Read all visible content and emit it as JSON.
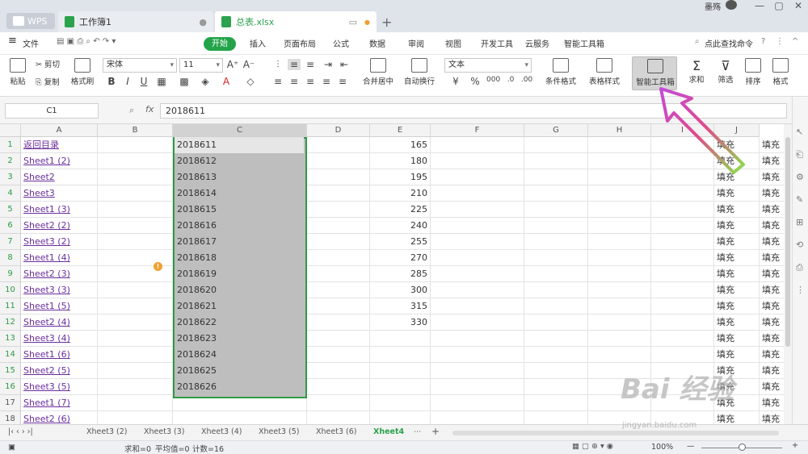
{
  "titlebar": {
    "wps": "WPS",
    "tab1": "工作簿1",
    "tab2": "总表.xlsx",
    "user": "墨殇"
  },
  "menu": {
    "file": "文件",
    "items": [
      "开始",
      "插入",
      "页面布局",
      "公式",
      "数据",
      "审阅",
      "视图",
      "开发工具",
      "云服务",
      "智能工具箱"
    ],
    "search": "点此查找命令"
  },
  "ribbon": {
    "paste": "粘贴",
    "cut": "剪切",
    "copy": "复制",
    "format_painter": "格式刷",
    "font": "宋体",
    "size": "11",
    "merge": "合并居中",
    "wrap": "自动换行",
    "numfmt": "文本",
    "cond": "条件格式",
    "table_style": "表格样式",
    "smart": "智能工具箱",
    "sum": "求和",
    "filter": "筛选",
    "sort": "排序",
    "format": "格式"
  },
  "formula": {
    "cell": "C1",
    "fx": "fx",
    "value": "2018611"
  },
  "columns": [
    "A",
    "B",
    "C",
    "D",
    "E",
    "F",
    "G",
    "H",
    "I",
    "J"
  ],
  "rows": [
    "1",
    "2",
    "3",
    "4",
    "5",
    "6",
    "7",
    "8",
    "9",
    "10",
    "11",
    "12",
    "13",
    "14",
    "15",
    "16",
    "17",
    "18"
  ],
  "colA": [
    "返回目录",
    "Sheet1 (2)",
    "Sheet2",
    "Sheet3",
    "Sheet1 (3)",
    "Sheet2 (2)",
    "Sheet3 (2)",
    "Sheet1 (4)",
    "Sheet2 (3)",
    "Sheet3 (3)",
    "Sheet1 (5)",
    "Sheet2 (4)",
    "Sheet3 (4)",
    "Sheet1 (6)",
    "Sheet2 (5)",
    "Sheet3 (5)",
    "Sheet1 (7)",
    "Sheet2 (6)"
  ],
  "colC": [
    "2018611",
    "2018612",
    "2018613",
    "2018614",
    "2018615",
    "2018616",
    "2018617",
    "2018618",
    "2018619",
    "2018620",
    "2018621",
    "2018622",
    "2018623",
    "2018624",
    "2018625",
    "2018626"
  ],
  "colE": [
    "165",
    "180",
    "195",
    "210",
    "225",
    "240",
    "255",
    "270",
    "285",
    "300",
    "315",
    "330"
  ],
  "fill": "填充",
  "sheets": [
    "Xheet3 (2)",
    "Xheet3 (3)",
    "Xheet3 (4)",
    "Xheet3 (5)",
    "Xheet3 (6)",
    "Xheet4"
  ],
  "status": {
    "sum": "求和=0",
    "avg": "平均值=0",
    "count": "计数=16",
    "zoom": "100%"
  },
  "watermark": {
    "main": "Bai 经验",
    "url": "jingyan.baidu.com"
  }
}
